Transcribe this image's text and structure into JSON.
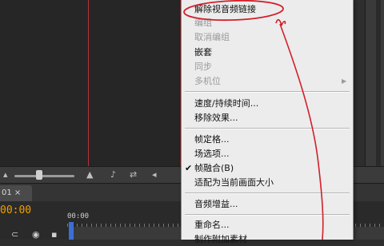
{
  "sequence_tab": {
    "label": "01 ×"
  },
  "timecode": "00:00",
  "ruler": {
    "start": "00:00"
  },
  "menu": {
    "items": [
      {
        "label": "解除视音频链接",
        "enabled": true
      },
      {
        "label": "编组",
        "enabled": false
      },
      {
        "label": "取消编组",
        "enabled": false
      },
      {
        "label": "嵌套",
        "enabled": true
      },
      {
        "label": "同步",
        "enabled": false
      },
      {
        "label": "多机位",
        "enabled": false
      },
      {
        "label": "速度/持续时间...",
        "enabled": true
      },
      {
        "label": "移除效果...",
        "enabled": true
      },
      {
        "label": "帧定格...",
        "enabled": true
      },
      {
        "label": "场选项...",
        "enabled": true
      },
      {
        "label": "帧融合(B)",
        "enabled": true,
        "checked": true
      },
      {
        "label": "适配为当前画面大小",
        "enabled": true
      },
      {
        "label": "音频增益...",
        "enabled": true
      },
      {
        "label": "重命名...",
        "enabled": true
      },
      {
        "label": "制作附加素材",
        "enabled": true
      }
    ]
  },
  "annotation_color": "#d21f2a",
  "icons": [
    "zoom-slider-icon",
    "mountain-icon",
    "audio-icon",
    "export-frame-icon",
    "snap-icon",
    "marker-icon"
  ]
}
